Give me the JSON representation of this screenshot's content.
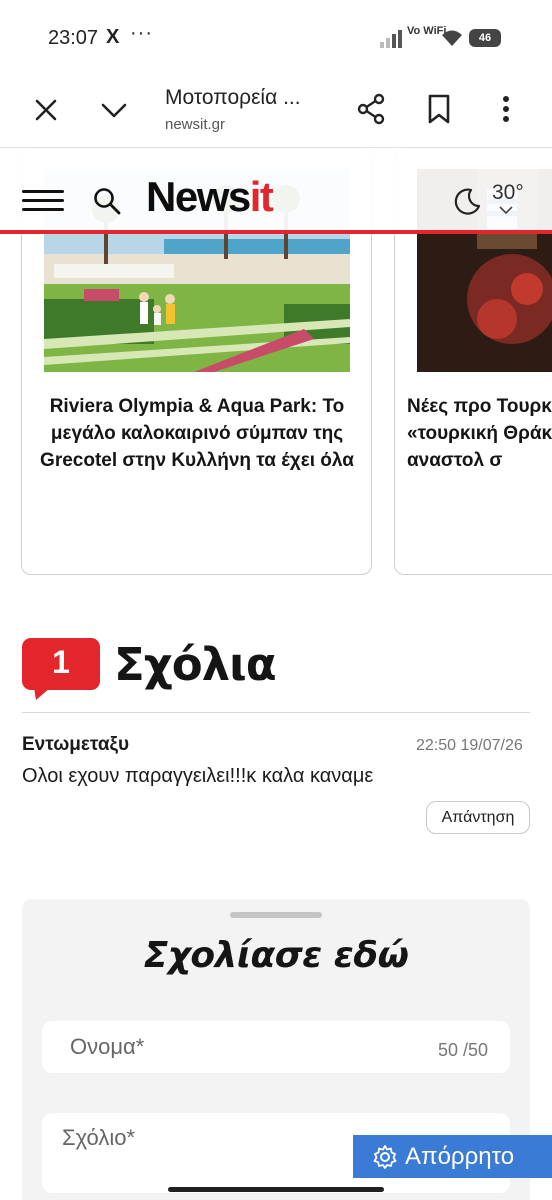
{
  "status_bar": {
    "time": "23:07",
    "x_icon": "X",
    "dots": "···",
    "network": "Vo WiFi",
    "battery": "46"
  },
  "browser": {
    "title": "Μοτοπορεία ...",
    "url": "newsit.gr"
  },
  "site_header": {
    "logo_main": "News",
    "logo_accent": "it",
    "temperature": "30°",
    "accent_color": "#e3262b"
  },
  "cards": [
    {
      "title": "Riviera Olympia & Aqua Park: Το μεγάλο καλοκαιρινό σύμπαν της Grecotel στην Κυλλήνη τα έχει όλα"
    },
    {
      "title": "Νέες προ Τουρκ «τουρκική Θράκη κ αναστολ σ"
    }
  ],
  "comments": {
    "count": "1",
    "heading": "Σχόλια",
    "items": [
      {
        "author": "Εντωμεταξυ",
        "date": "22:50 19/07/26",
        "text": "Ολοι εχουν παραγγειλει!!!κ καλα καναμε",
        "reply_label": "Απάντηση"
      }
    ]
  },
  "form": {
    "title": "Σχολίασε εδώ",
    "name_placeholder": "Ονομα*",
    "name_counter": "50 /50",
    "comment_placeholder": "Σχόλιο*"
  },
  "privacy_button": {
    "label": "Απόρρητο"
  }
}
